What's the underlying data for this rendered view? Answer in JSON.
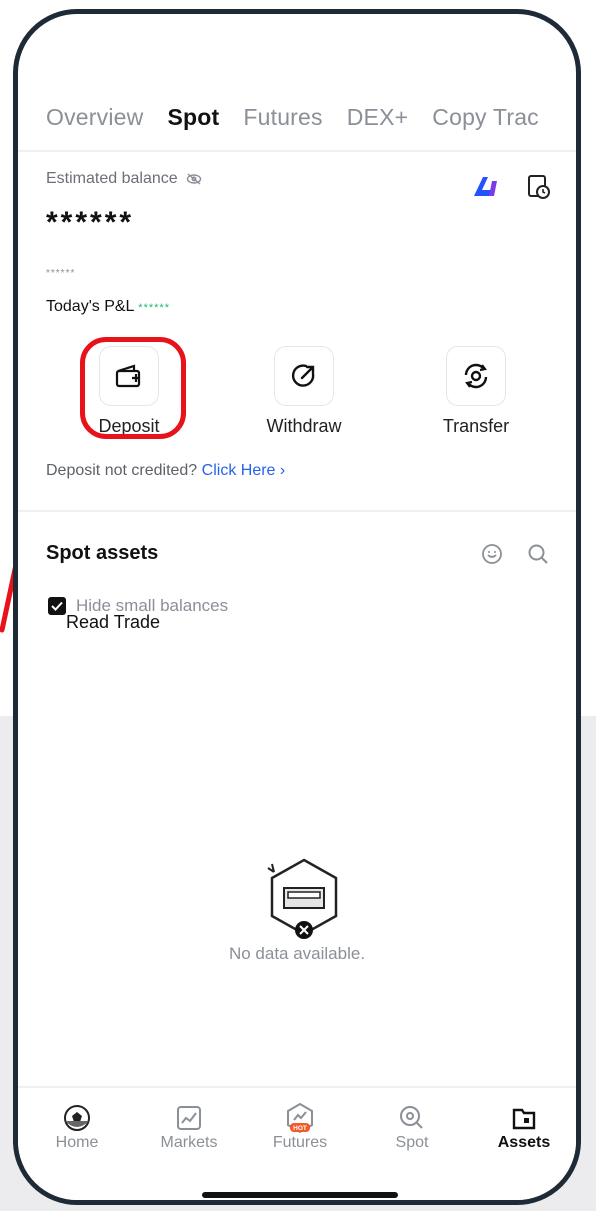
{
  "tabs": [
    "Overview",
    "Spot",
    "Futures",
    "DEX+",
    "Copy Trac"
  ],
  "balance": {
    "label": "Estimated balance",
    "value": "******",
    "sub_value": "******",
    "pnl_label": "Today's P&L",
    "pnl_value": "******"
  },
  "actions": {
    "deposit": "Deposit",
    "withdraw": "Withdraw",
    "transfer": "Transfer"
  },
  "notice": {
    "text": "Deposit not credited?",
    "link": "Click Here",
    "chevron": "›"
  },
  "spot_assets": {
    "title": "Spot assets",
    "hide_small": "Hide small balances"
  },
  "overlay_text": "Read Trade",
  "empty_state": "No data available.",
  "nav": [
    {
      "label": "Home",
      "icon": "home-ball-icon"
    },
    {
      "label": "Markets",
      "icon": "markets-chart-icon"
    },
    {
      "label": "Futures",
      "icon": "futures-hot-icon",
      "badge": "HOT"
    },
    {
      "label": "Spot",
      "icon": "spot-icon"
    },
    {
      "label": "Assets",
      "icon": "assets-wallet-icon"
    }
  ],
  "colors": {
    "accent_link": "#2563eb",
    "pnl_green": "#1eb870",
    "highlight_red": "#e8121a"
  }
}
